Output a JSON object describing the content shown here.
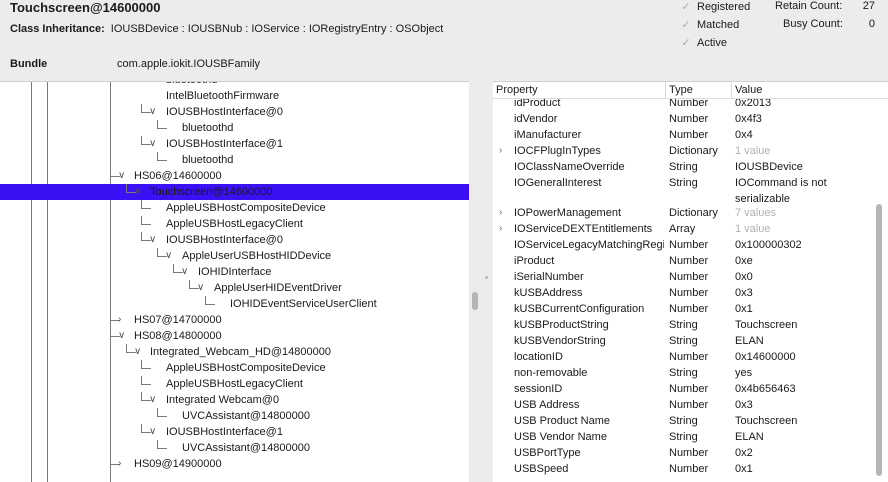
{
  "header": {
    "title": "Touchscreen@14600000",
    "inheritance_label": "Class Inheritance:",
    "inheritance_value": "IOUSBDevice : IOUSBNub : IOService : IORegistryEntry : OSObject",
    "bundle_label": "Bundle",
    "bundle_value": "com.apple.iokit.IOUSBFamily",
    "checks": [
      "Registered",
      "Matched",
      "Active"
    ],
    "retain_label": "Retain Count:",
    "retain_value": "27",
    "busy_label": "Busy Count:",
    "busy_value": "0"
  },
  "tree": {
    "rows": [
      {
        "label": "bluetoothd",
        "selected": false
      },
      {
        "label": "IntelBluetoothFirmware",
        "selected": false
      },
      {
        "label": "IOUSBHostInterface@0",
        "selected": false
      },
      {
        "label": "bluetoothd",
        "selected": false
      },
      {
        "label": "IOUSBHostInterface@1",
        "selected": false
      },
      {
        "label": "bluetoothd",
        "selected": false
      },
      {
        "label": "HS06@14600000",
        "selected": false
      },
      {
        "label": "Touchscreen@14600000",
        "selected": true
      },
      {
        "label": "AppleUSBHostCompositeDevice",
        "selected": false
      },
      {
        "label": "AppleUSBHostLegacyClient",
        "selected": false
      },
      {
        "label": "IOUSBHostInterface@0",
        "selected": false
      },
      {
        "label": "AppleUserUSBHostHIDDevice",
        "selected": false
      },
      {
        "label": "IOHIDInterface",
        "selected": false
      },
      {
        "label": "AppleUserHIDEventDriver",
        "selected": false
      },
      {
        "label": "IOHIDEventServiceUserClient",
        "selected": false
      },
      {
        "label": "HS07@14700000",
        "selected": false
      },
      {
        "label": "HS08@14800000",
        "selected": false
      },
      {
        "label": "Integrated_Webcam_HD@14800000",
        "selected": false
      },
      {
        "label": "AppleUSBHostCompositeDevice",
        "selected": false
      },
      {
        "label": "AppleUSBHostLegacyClient",
        "selected": false
      },
      {
        "label": "Integrated Webcam@0",
        "selected": false
      },
      {
        "label": "UVCAssistant@14800000",
        "selected": false
      },
      {
        "label": "IOUSBHostInterface@1",
        "selected": false
      },
      {
        "label": "UVCAssistant@14800000",
        "selected": false
      },
      {
        "label": "HS09@14900000",
        "selected": false
      }
    ]
  },
  "properties": {
    "columns": [
      "Property",
      "Type",
      "Value"
    ],
    "rows": [
      {
        "name": "idProduct",
        "type": "Number",
        "value": "0x2013"
      },
      {
        "name": "idVendor",
        "type": "Number",
        "value": "0x4f3"
      },
      {
        "name": "iManufacturer",
        "type": "Number",
        "value": "0x4"
      },
      {
        "name": "IOCFPlugInTypes",
        "type": "Dictionary",
        "value": "1 value",
        "expandable": true,
        "dim": true
      },
      {
        "name": "IOClassNameOverride",
        "type": "String",
        "value": "IOUSBDevice"
      },
      {
        "name": "IOGeneralInterest",
        "type": "String",
        "value": "IOCommand is not serializable",
        "tall": true
      },
      {
        "name": "IOPowerManagement",
        "type": "Dictionary",
        "value": "7 values",
        "expandable": true,
        "dim": true
      },
      {
        "name": "IOServiceDEXTEntitlements",
        "type": "Array",
        "value": "1 value",
        "expandable": true,
        "dim": true
      },
      {
        "name": "IOServiceLegacyMatchingRegistryID",
        "type": "Number",
        "value": "0x100000302"
      },
      {
        "name": "iProduct",
        "type": "Number",
        "value": "0xe"
      },
      {
        "name": "iSerialNumber",
        "type": "Number",
        "value": "0x0"
      },
      {
        "name": "kUSBAddress",
        "type": "Number",
        "value": "0x3"
      },
      {
        "name": "kUSBCurrentConfiguration",
        "type": "Number",
        "value": "0x1"
      },
      {
        "name": "kUSBProductString",
        "type": "String",
        "value": "Touchscreen"
      },
      {
        "name": "kUSBVendorString",
        "type": "String",
        "value": "ELAN"
      },
      {
        "name": "locationID",
        "type": "Number",
        "value": "0x14600000"
      },
      {
        "name": "non-removable",
        "type": "String",
        "value": "yes"
      },
      {
        "name": "sessionID",
        "type": "Number",
        "value": "0x4b656463"
      },
      {
        "name": "USB Address",
        "type": "Number",
        "value": "0x3"
      },
      {
        "name": "USB Product Name",
        "type": "String",
        "value": "Touchscreen"
      },
      {
        "name": "USB Vendor Name",
        "type": "String",
        "value": "ELAN"
      },
      {
        "name": "USBPortType",
        "type": "Number",
        "value": "0x2"
      },
      {
        "name": "USBSpeed",
        "type": "Number",
        "value": "0x1"
      }
    ]
  }
}
